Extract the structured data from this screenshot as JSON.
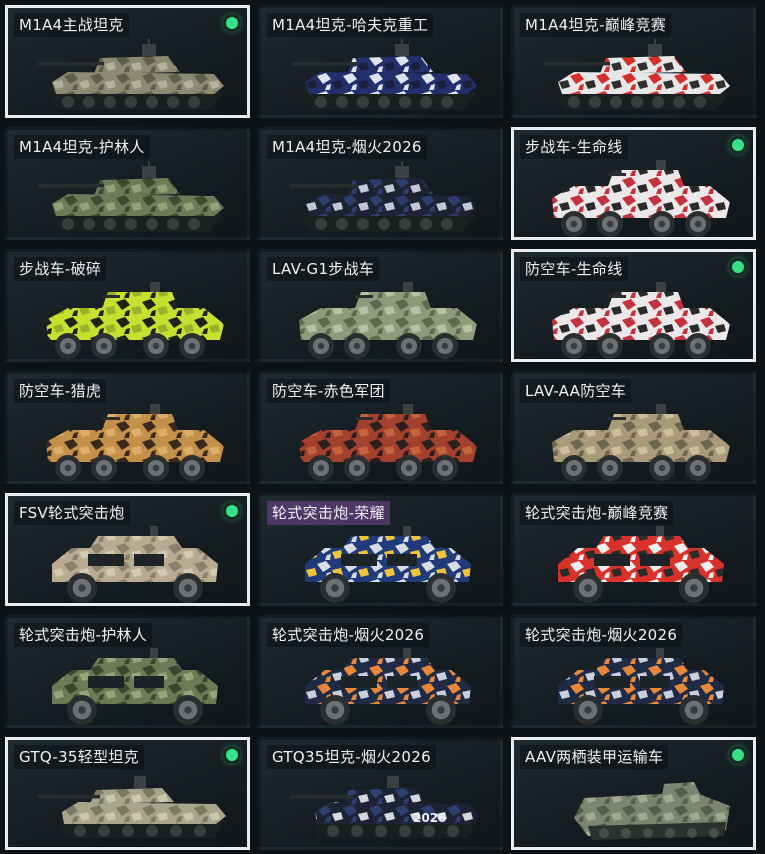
{
  "colors": {
    "selected_border": "#e9edf0",
    "equipped_dot": "#39e08a",
    "background": "#0d1216"
  },
  "vehicles": [
    {
      "label": "M1A4主战坦克",
      "type": "tank",
      "selected": true,
      "equipped": true,
      "camo": [
        "#8c8a72",
        "#5e5e4c",
        "#b3b19a"
      ],
      "highlight": false
    },
    {
      "label": "M1A4坦克-哈夫克重工",
      "type": "tank",
      "selected": false,
      "equipped": false,
      "camo": [
        "#24306e",
        "#dfe3ee",
        "#1b1f3a"
      ],
      "highlight": false
    },
    {
      "label": "M1A4坦克-巅峰竞赛",
      "type": "tank",
      "selected": false,
      "equipped": false,
      "camo": [
        "#e7e7e7",
        "#d3302b",
        "#2f2f2f"
      ],
      "highlight": false
    },
    {
      "label": "M1A4坦克-护林人",
      "type": "tank",
      "selected": false,
      "equipped": false,
      "camo": [
        "#6f7a58",
        "#3f4a33",
        "#98a07a"
      ],
      "highlight": false
    },
    {
      "label": "M1A4坦克-烟火2026",
      "type": "tank",
      "selected": false,
      "equipped": false,
      "camo": [
        "#1d2332",
        "#2d3d6e",
        "#c2c7d6"
      ],
      "highlight": false
    },
    {
      "label": "步战车-生命线",
      "type": "ifv",
      "selected": true,
      "equipped": true,
      "camo": [
        "#ece8ea",
        "#c2333d",
        "#2a2a2a"
      ],
      "highlight": false
    },
    {
      "label": "步战车-破碎",
      "type": "ifv",
      "selected": false,
      "equipped": false,
      "camo": [
        "#c7df2e",
        "#1c2418",
        "#9ab12a"
      ],
      "highlight": false
    },
    {
      "label": "LAV-G1步战车",
      "type": "ifv",
      "selected": false,
      "equipped": false,
      "camo": [
        "#8e9a7a",
        "#5d6a4e",
        "#b8c0a6"
      ],
      "highlight": false
    },
    {
      "label": "防空车-生命线",
      "type": "ifv",
      "selected": true,
      "equipped": true,
      "camo": [
        "#ece8ea",
        "#c2333d",
        "#2a2a2a"
      ],
      "highlight": false
    },
    {
      "label": "防空车-猎虎",
      "type": "ifv",
      "selected": false,
      "equipped": false,
      "camo": [
        "#c4904a",
        "#3b2a1c",
        "#dcae6a"
      ],
      "highlight": false
    },
    {
      "label": "防空车-赤色军团",
      "type": "ifv",
      "selected": false,
      "equipped": false,
      "camo": [
        "#a4412e",
        "#2c1f1d",
        "#c4643e"
      ],
      "highlight": false
    },
    {
      "label": "LAV-AA防空车",
      "type": "ifv",
      "selected": false,
      "equipped": false,
      "camo": [
        "#a99b79",
        "#6f6650",
        "#cdbf9c"
      ],
      "highlight": false
    },
    {
      "label": "FSV轮式突击炮",
      "type": "fsv",
      "selected": true,
      "equipped": true,
      "camo": [
        "#b9ab92",
        "#8d816b",
        "#d4c8b0"
      ],
      "highlight": false
    },
    {
      "label": "轮式突击炮-荣耀",
      "type": "fsv",
      "selected": false,
      "equipped": false,
      "camo": [
        "#1f3b7a",
        "#d8dde4",
        "#f0c43a"
      ],
      "highlight": true
    },
    {
      "label": "轮式突击炮-巅峰竞赛",
      "type": "fsv",
      "selected": false,
      "equipped": false,
      "camo": [
        "#d8322a",
        "#efefef",
        "#2c2c2c"
      ],
      "highlight": false
    },
    {
      "label": "轮式突击炮-护林人",
      "type": "fsv",
      "selected": false,
      "equipped": false,
      "camo": [
        "#6e7a55",
        "#3d4631",
        "#9aa37b"
      ],
      "highlight": false
    },
    {
      "label": "轮式突击炮-烟火2026",
      "type": "fsv",
      "selected": false,
      "equipped": false,
      "camo": [
        "#1f2a44",
        "#e7873a",
        "#c9cfdd"
      ],
      "highlight": false
    },
    {
      "label": "轮式突击炮-烟火2026",
      "type": "fsv",
      "selected": false,
      "equipped": false,
      "camo": [
        "#1f2a44",
        "#e7873a",
        "#c9cfdd"
      ],
      "highlight": false
    },
    {
      "label": "GTQ-35轻型坦克",
      "type": "light_tank",
      "selected": true,
      "equipped": true,
      "camo": [
        "#a9a58c",
        "#7c7963",
        "#cbc7ad"
      ],
      "highlight": false
    },
    {
      "label": "GTQ35坦克-烟火2026",
      "type": "light_tank",
      "selected": false,
      "equipped": false,
      "camo": [
        "#1d2334",
        "#2e3f72",
        "#d6d8e0"
      ],
      "highlight": false,
      "badge": "2026"
    },
    {
      "label": "AAV两栖装甲运输车",
      "type": "aav",
      "selected": true,
      "equipped": true,
      "camo": [
        "#7d8470",
        "#565d4c",
        "#a3a891"
      ],
      "highlight": false
    }
  ]
}
